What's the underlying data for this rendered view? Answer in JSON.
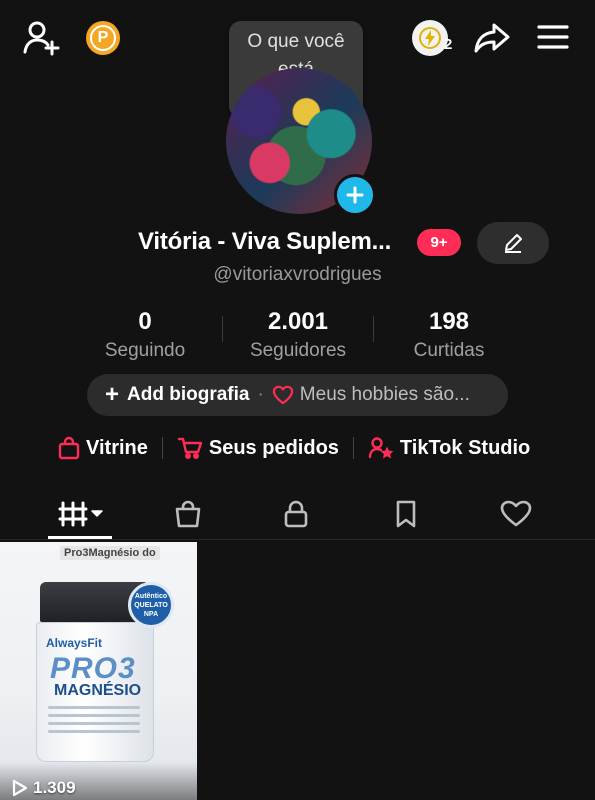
{
  "top_bar": {
    "bolt_count": "2"
  },
  "avatar": {
    "thought_bubble": "O que você está pensando..."
  },
  "profile": {
    "display_name": "Vitória - Viva Suplem...",
    "notification_badge": "9+",
    "username": "@vitoriaxvrodrigues"
  },
  "stats": [
    {
      "value": "0",
      "label": "Seguindo"
    },
    {
      "value": "2.001",
      "label": "Seguidores"
    },
    {
      "value": "198",
      "label": "Curtidas"
    }
  ],
  "bio": {
    "add_label": "Add biografia",
    "separator": "·",
    "hobbies_prompt": "Meus hobbies são..."
  },
  "links": [
    {
      "label": "Vitrine",
      "icon": "shopping-bag-icon"
    },
    {
      "label": "Seus pedidos",
      "icon": "cart-icon"
    },
    {
      "label": "TikTok Studio",
      "icon": "creator-star-icon"
    }
  ],
  "tabs": [
    {
      "name": "videos-grid",
      "icon": "grid-icon",
      "active": true
    },
    {
      "name": "shop",
      "icon": "bag-icon"
    },
    {
      "name": "private",
      "icon": "lock-icon"
    },
    {
      "name": "saved",
      "icon": "bookmark-icon"
    },
    {
      "name": "liked",
      "icon": "heart-icon"
    }
  ],
  "videos": [
    {
      "overlay_title": "Pro3Magnésio do",
      "views": "1.309",
      "product_brand": "AlwaysFit",
      "product_name": "PRO3",
      "product_sub": "MAGNÉSIO",
      "seal_top": "Autêntico",
      "seal_mid": "QUELATO",
      "seal_bottom": "NPA"
    }
  ],
  "colors": {
    "background": "#121212",
    "accent_red": "#ff2d55",
    "avatar_add_blue": "#20b8e8",
    "points_orange": "#f5a623"
  }
}
